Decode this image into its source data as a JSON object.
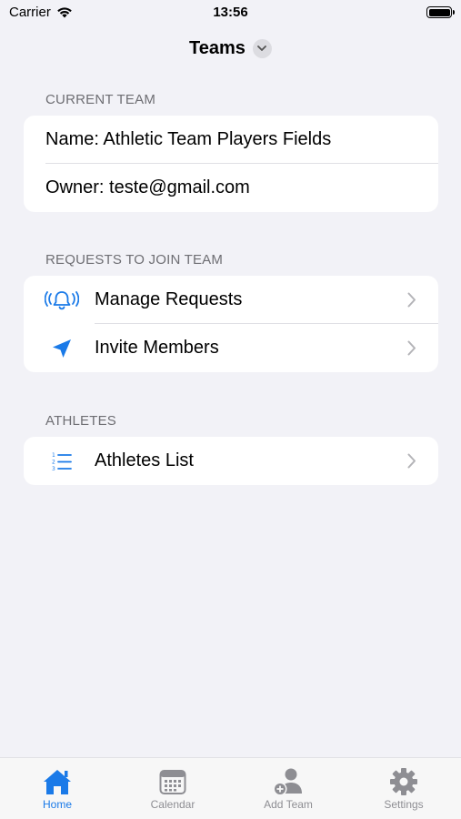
{
  "status_bar": {
    "carrier": "Carrier",
    "time": "13:56"
  },
  "nav": {
    "title": "Teams"
  },
  "current_team": {
    "header": "CURRENT TEAM",
    "name": "Name: Athletic Team Players Fields",
    "owner": "Owner: teste@gmail.com"
  },
  "requests": {
    "header": "REQUESTS TO JOIN TEAM",
    "items": [
      {
        "label": "Manage Requests",
        "icon": "bell-icon"
      },
      {
        "label": "Invite Members",
        "icon": "paperplane-icon"
      }
    ]
  },
  "athletes": {
    "header": "ATHLETES",
    "items": [
      {
        "label": "Athletes List",
        "icon": "list-icon"
      }
    ]
  },
  "tabbar": {
    "active": "Home",
    "items": [
      {
        "label": "Home",
        "icon": "house-icon"
      },
      {
        "label": "Calendar",
        "icon": "calendar-icon"
      },
      {
        "label": "Add Team",
        "icon": "add-person-icon"
      },
      {
        "label": "Settings",
        "icon": "gear-icon"
      }
    ]
  },
  "colors": {
    "accent": "#1a7ae8",
    "background": "#f2f2f7",
    "inactive": "#8e8e93"
  }
}
